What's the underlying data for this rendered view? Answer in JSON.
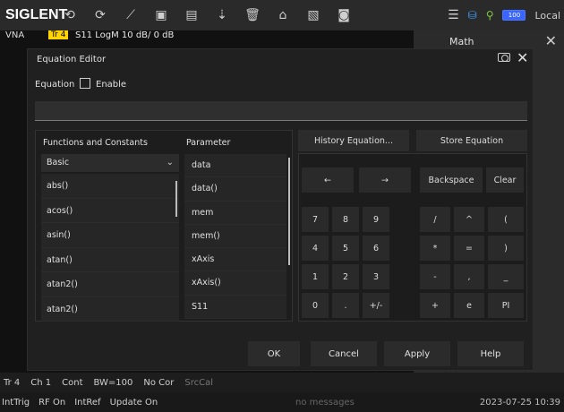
{
  "topbar": {
    "brand": "SIGLENT",
    "icons": [
      "undo-icon",
      "redo-icon",
      "add-trace-icon",
      "tr-plus-icon",
      "ch-plus-icon",
      "marker-plus-icon",
      "delete-icon",
      "home-icon",
      "save-icon",
      "screenshot-icon"
    ],
    "right_icons": [
      "menu-icon",
      "network-icon",
      "usb-icon"
    ],
    "battery": "100",
    "local": "Local"
  },
  "trace": {
    "vna": "VNA",
    "tag": "Tr 4",
    "text": "S11  LogM  10 dB/  0 dB"
  },
  "rightpane": {
    "title": "Math",
    "chevron": "⌄"
  },
  "dialog": {
    "title": "Equation Editor",
    "equation_label": "Equation",
    "enable_label": "Enable",
    "equation_value": "",
    "functions_header": "Functions and Constants",
    "parameter_header": "Parameter",
    "category": "Basic",
    "functions": [
      "abs()",
      "acos()",
      "asin()",
      "atan()",
      "atan2()",
      "atan2()"
    ],
    "parameters": [
      "data",
      "data()",
      "mem",
      "mem()",
      "xAxis",
      "xAxis()",
      "S11"
    ],
    "history_btn": "History Equation...",
    "store_btn": "Store Equation",
    "keys_row1": [
      "←",
      "→",
      "Backspace",
      "Clear"
    ],
    "keys_row2": [
      "7",
      "8",
      "9",
      "/",
      "^",
      "("
    ],
    "keys_row3": [
      "4",
      "5",
      "6",
      "*",
      "=",
      ")"
    ],
    "keys_row4": [
      "1",
      "2",
      "3",
      "-",
      ",",
      "_"
    ],
    "keys_row5": [
      "0",
      ".",
      "+/-",
      "+",
      "e",
      "PI"
    ],
    "ok": "OK",
    "cancel": "Cancel",
    "apply": "Apply",
    "help": "Help"
  },
  "status1": [
    "Tr 4",
    "Ch 1",
    "Cont",
    "BW=100",
    "No Cor",
    "SrcCal"
  ],
  "status2": [
    "IntTrig",
    "RF On",
    "IntRef",
    "Update On"
  ],
  "message": "no messages",
  "datetime": "2023-07-25 10:39"
}
